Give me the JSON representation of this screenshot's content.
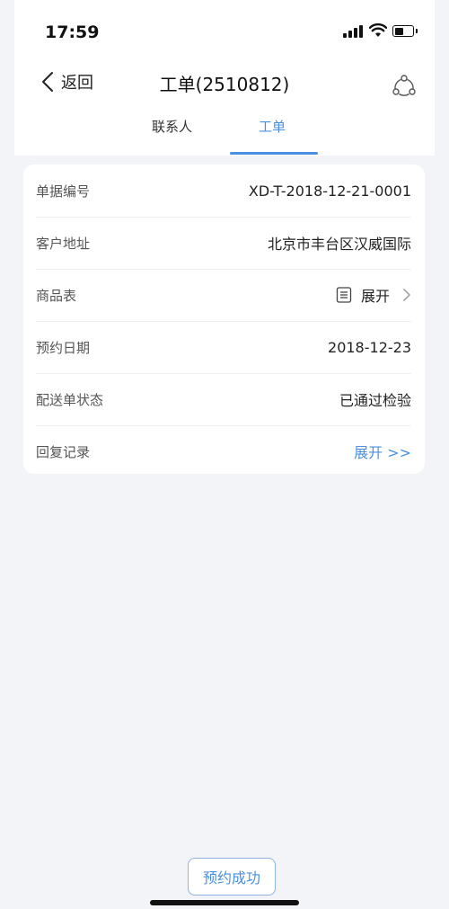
{
  "status_bar": {
    "time": "17:59"
  },
  "nav": {
    "back_label": "返回",
    "title": "工单(2510812)"
  },
  "tabs": [
    {
      "label": "联系人",
      "active": false
    },
    {
      "label": "工单",
      "active": true
    }
  ],
  "details": {
    "order_no": {
      "label": "单据编号",
      "value": "XD-T-2018-12-21-0001"
    },
    "address": {
      "label": "客户地址",
      "value": "北京市丰台区汉威国际"
    },
    "product_list": {
      "label": "商品表",
      "value": "展开"
    },
    "appointment_date": {
      "label": "预约日期",
      "value": "2018-12-23"
    },
    "delivery_status": {
      "label": "配送单状态",
      "value": "已通过检验"
    },
    "reply_records": {
      "label": "回复记录",
      "value": "展开 >>"
    }
  },
  "footer": {
    "appointment_button": "预约成功"
  },
  "colors": {
    "accent": "#4a90e2",
    "background": "#f2f4f7"
  }
}
